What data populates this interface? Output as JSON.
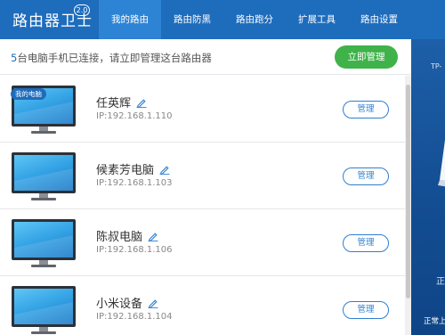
{
  "app": {
    "title": "路由器卫士",
    "version": "2.0"
  },
  "nav": {
    "tabs": [
      "我的路由",
      "路由防黑",
      "路由跑分",
      "扩展工具",
      "路由设置"
    ],
    "active": 0
  },
  "info": {
    "count": "5",
    "text": "台电脑手机已连接，请立即管理这台路由器",
    "manage_now": "立即管理"
  },
  "devices": [
    {
      "name": "任英辉",
      "ip": "IP:192.168.1.110",
      "badge": "我的电脑",
      "button": "管理"
    },
    {
      "name": "候素芳电脑",
      "ip": "IP:192.168.1.103",
      "button": "管理"
    },
    {
      "name": "陈叔电脑",
      "ip": "IP:192.168.1.106",
      "button": "管理"
    },
    {
      "name": "小米设备",
      "ip": "IP:192.168.1.104",
      "button": "管理"
    }
  ],
  "right_panel": {
    "router_label": "TP-",
    "mark": "正",
    "status": "正常上"
  },
  "colors": {
    "header": "#1e6cbc",
    "active_tab": "#2d83d4",
    "green_button": "#3fb349",
    "outline_button": "#2f7fd0"
  }
}
